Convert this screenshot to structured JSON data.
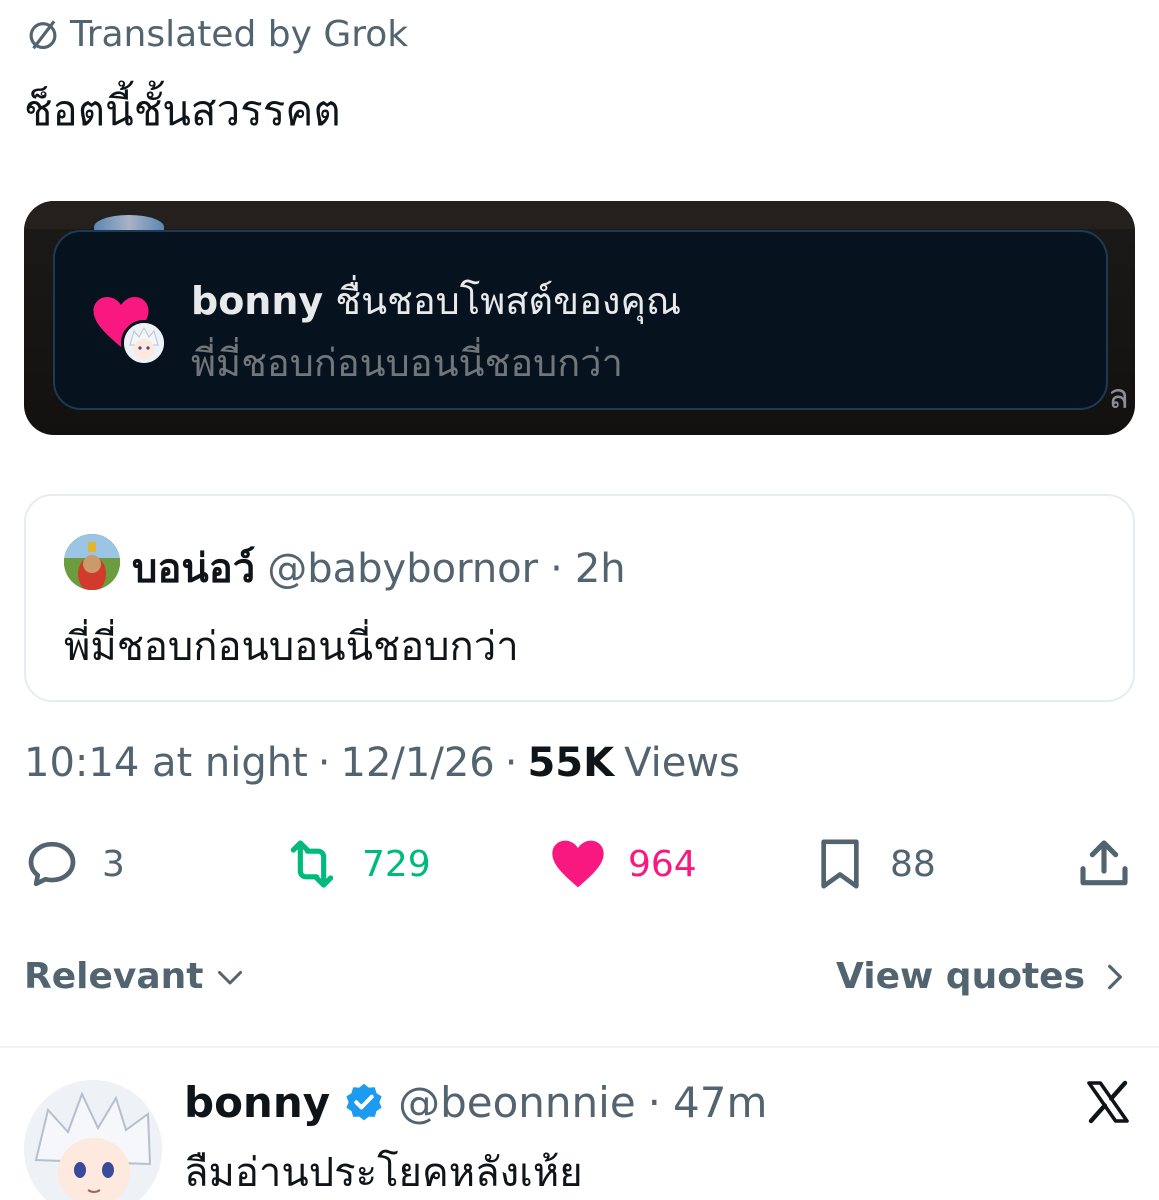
{
  "translation": {
    "label": "Translated by Grok",
    "icon": "translate-slash-icon"
  },
  "tweet": {
    "text": "ช็อตนี้ชั้นสวรรคต",
    "timestamp": "10:14 at night",
    "date": "12/1/26",
    "views_count": "55K",
    "views_label": "Views",
    "separator": "·"
  },
  "media": {
    "notification": {
      "name": "bonny",
      "action": "ชื่นชอบโพสต์ของคุณ",
      "text": "พี่มี่ชอบก่อนบอนนี่ชอบกว่า"
    },
    "edge_glyph": "ล"
  },
  "quote": {
    "name": "บอน่อว์",
    "handle": "@babybornor",
    "separator": "·",
    "time": "2h",
    "text": "พี่มี่ชอบก่อนบอนนี่ชอบกว่า"
  },
  "actions": {
    "replies": "3",
    "reposts": "729",
    "likes": "964",
    "bookmarks": "88"
  },
  "replies_header": {
    "sort_label": "Relevant",
    "view_quotes_label": "View quotes"
  },
  "reply": {
    "name": "bonny",
    "handle": "@beonnnie",
    "separator": "·",
    "time": "47m",
    "text": "ลืมอ่านประโยคหลังเห้ย"
  },
  "colors": {
    "repost": "#00ba7c",
    "like": "#f91880",
    "secondary_text": "#536471",
    "verified": "#1d9bf0"
  }
}
